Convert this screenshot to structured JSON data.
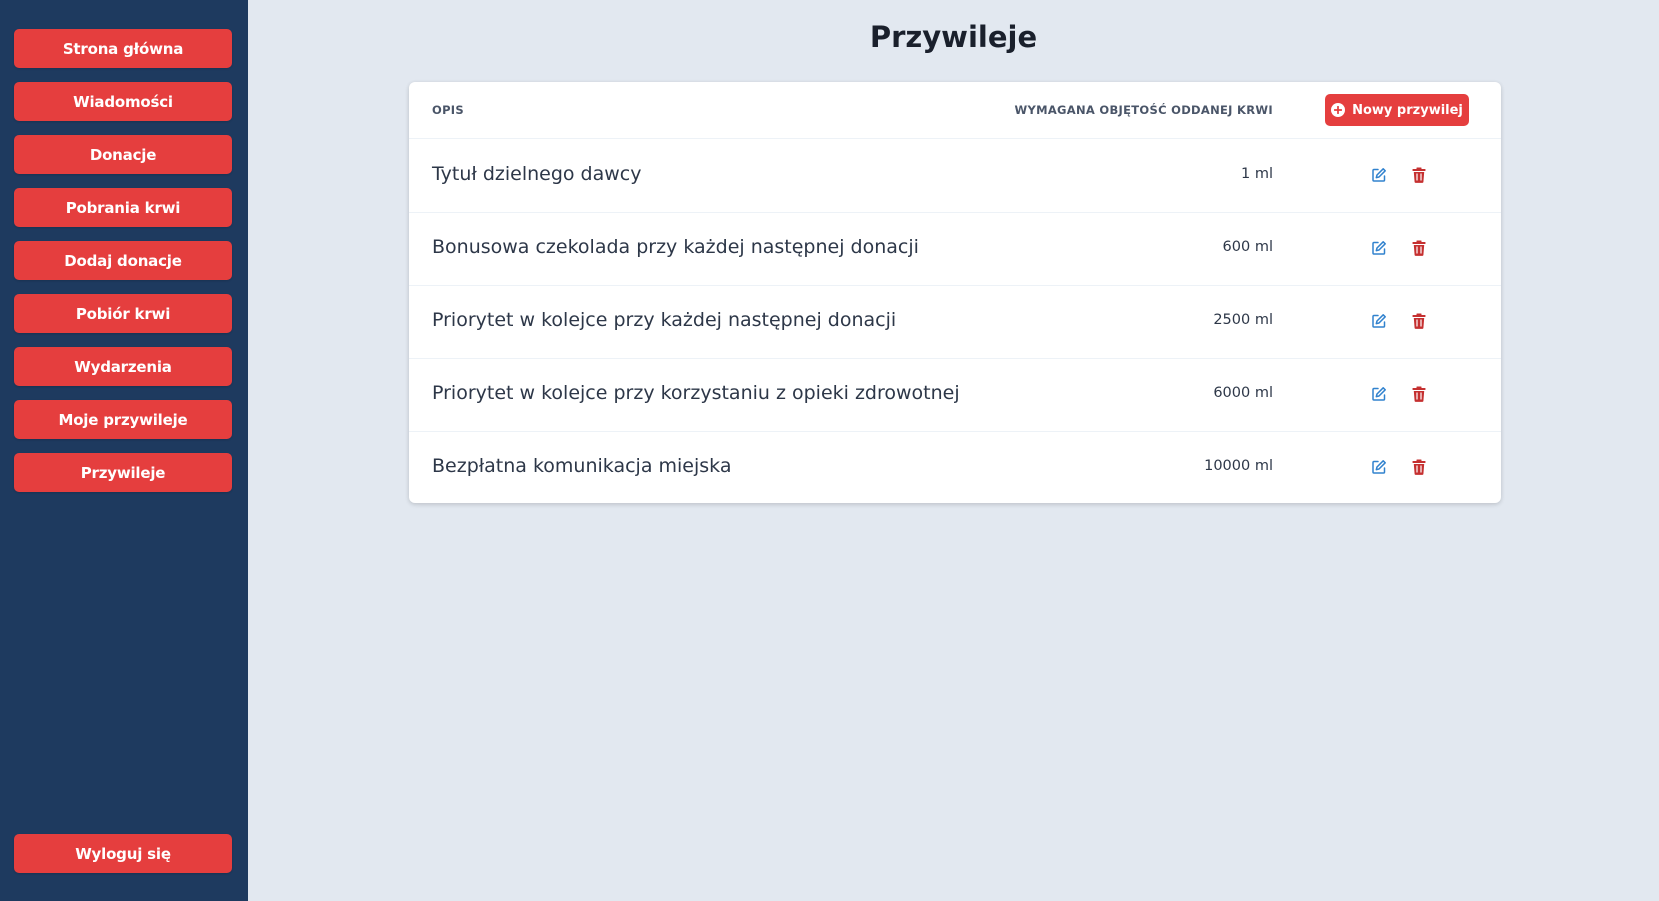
{
  "sidebar": {
    "items": [
      {
        "label": "Strona główna"
      },
      {
        "label": "Wiadomości"
      },
      {
        "label": "Donacje"
      },
      {
        "label": "Pobrania krwi"
      },
      {
        "label": "Dodaj donacje"
      },
      {
        "label": "Pobiór krwi"
      },
      {
        "label": "Wydarzenia"
      },
      {
        "label": "Moje przywileje"
      },
      {
        "label": "Przywileje"
      }
    ],
    "logout_label": "Wyloguj się"
  },
  "page": {
    "title": "Przywileje"
  },
  "table": {
    "columns": {
      "description": "OPIS",
      "volume": "WYMAGANA OBJĘTOŚĆ ODDANEJ KRWI"
    },
    "new_button_label": "Nowy przywilej",
    "rows": [
      {
        "description": "Tytuł dzielnego dawcy",
        "volume": "1 ml"
      },
      {
        "description": "Bonusowa czekolada przy każdej następnej donacji",
        "volume": "600 ml"
      },
      {
        "description": "Priorytet w kolejce przy każdej następnej donacji",
        "volume": "2500 ml"
      },
      {
        "description": "Priorytet w kolejce przy korzystaniu z opieki zdrowotnej",
        "volume": "6000 ml"
      },
      {
        "description": "Bezpłatna komunikacja miejska",
        "volume": "10000 ml"
      }
    ]
  },
  "icons": {
    "new": "plus-circle-icon",
    "edit": "edit-icon",
    "delete": "trash-icon"
  },
  "colors": {
    "sidebar_bg": "#1e3a5f",
    "accent": "#e53e3e",
    "page_bg": "#e2e8f0",
    "edit_icon": "#3182ce",
    "delete_icon": "#c53030"
  }
}
